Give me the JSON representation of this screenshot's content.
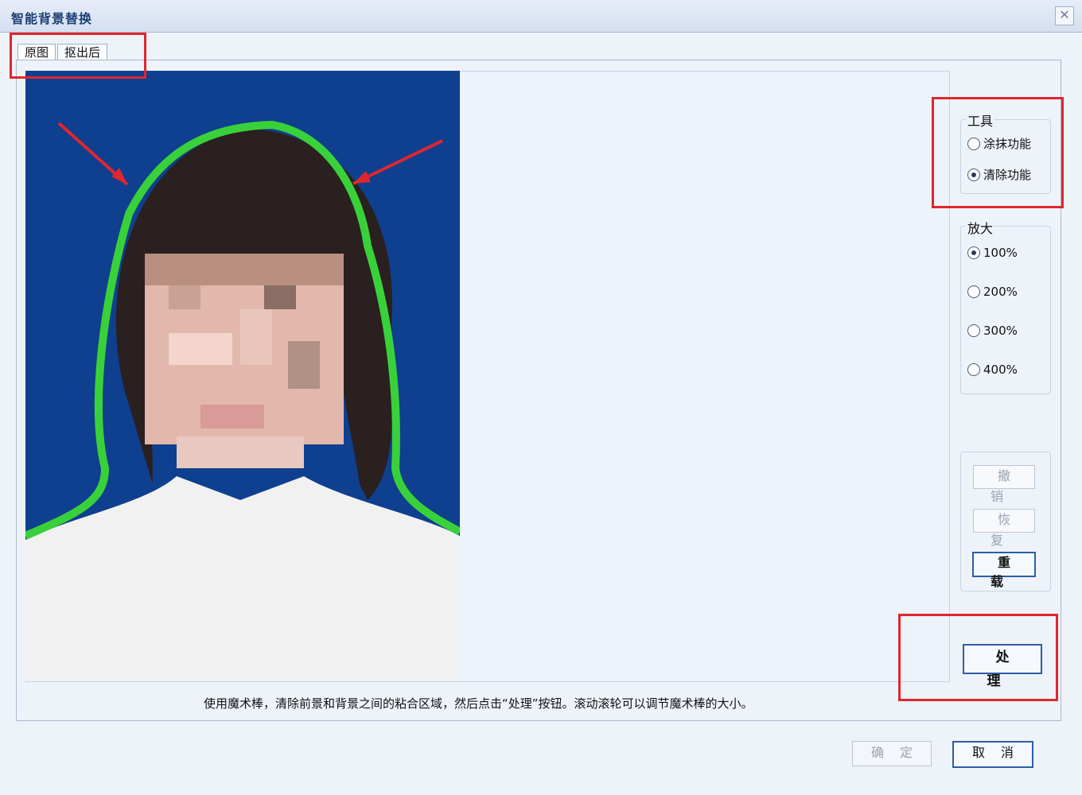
{
  "window": {
    "title": "智能背景替换",
    "close": "✕"
  },
  "tabs": [
    {
      "label": "原图",
      "active": true
    },
    {
      "label": "抠出后",
      "active": false
    }
  ],
  "tool_group": {
    "label": "工具",
    "options": [
      {
        "label": "涂抹功能",
        "checked": false
      },
      {
        "label": "清除功能",
        "checked": true
      }
    ]
  },
  "zoom_group": {
    "label": "放大",
    "options": [
      {
        "label": "100%",
        "checked": true
      },
      {
        "label": "200%",
        "checked": false
      },
      {
        "label": "300%",
        "checked": false
      },
      {
        "label": "400%",
        "checked": false
      }
    ]
  },
  "edit_buttons": {
    "undo": "撤销",
    "redo": "恢复",
    "reload": "重载"
  },
  "process_button": "处理",
  "hint": "使用魔术棒，清除前景和背景之间的粘合区域，然后点击“处理”按钮。滚动滚轮可以调节魔术棒的大小。",
  "dialog_buttons": {
    "ok": "确定",
    "cancel": "取消"
  },
  "colors": {
    "photo_background": "#0f3f8f",
    "outline": "#39d13a",
    "highlight": "#e0262e"
  }
}
